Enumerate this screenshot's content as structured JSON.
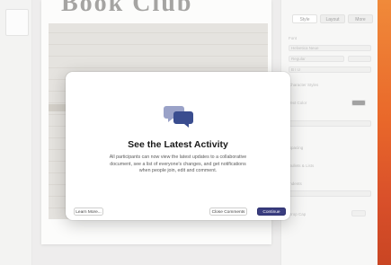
{
  "document": {
    "title": "Book Club"
  },
  "inspector": {
    "tabs": [
      "Style",
      "Layout",
      "More"
    ],
    "rows": [
      "Font",
      "Helvetica Neue",
      "Regular",
      "B   I   U",
      "Character Styles",
      "Text Color",
      "Spacing",
      "Bullets & Lists",
      "Indents",
      "Drop Cap"
    ]
  },
  "modal": {
    "title": "See the Latest Activity",
    "body": "All participants can now view the latest updates to a collaborative document, see a list of everyone's changes, and get notifications when people join, edit and comment.",
    "buttons": {
      "learn_more": "Learn More...",
      "close_comments": "Close Comments",
      "continue": "Continue"
    },
    "icon": "speech-bubbles-icon"
  },
  "colors": {
    "accent": "#3a3d7f",
    "desktop": "#e9682a"
  }
}
